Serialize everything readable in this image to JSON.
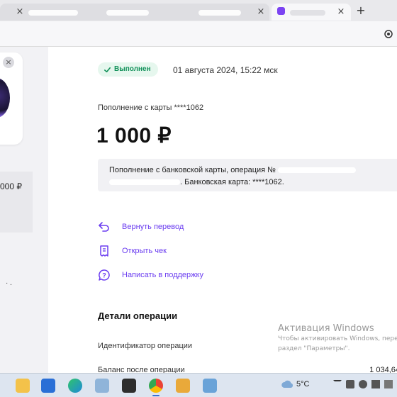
{
  "browser": {
    "active_tab_close": "×",
    "background_tab_close": "×",
    "new_tab_label": "+"
  },
  "left_panel": {
    "close_label": "×",
    "amount_fragment": "000 ₽",
    "dots": "· ."
  },
  "operation": {
    "status": "Выполнен",
    "date": "01 августа 2024, 15:22 мск",
    "subtitle": "Пополнение с карты ****1062",
    "amount": "1 000 ₽",
    "description_line1": "Пополнение с банковской карты, операция №",
    "description_line2": ". Банковская карта: ****1062."
  },
  "actions": [
    {
      "label": "Вернуть перевод",
      "icon": "return-arrow-icon"
    },
    {
      "label": "Открыть чек",
      "icon": "receipt-icon"
    },
    {
      "label": "Написать в поддержку",
      "icon": "support-chat-icon"
    }
  ],
  "details": {
    "title": "Детали операции",
    "rows": [
      {
        "label": "Идентификатор операции",
        "value": ""
      },
      {
        "label": "Баланс после операции",
        "value": "1 034,64"
      }
    ]
  },
  "watermark": {
    "title": "Активация Windows",
    "line1": "Чтобы активировать Windows, перейдите в",
    "line2": "раздел \"Параметры\"."
  },
  "taskbar": {
    "weather_temp": "5°C"
  },
  "colors": {
    "accent": "#6b3df0",
    "success": "#12915a",
    "success_bg": "#e6f7ee"
  }
}
